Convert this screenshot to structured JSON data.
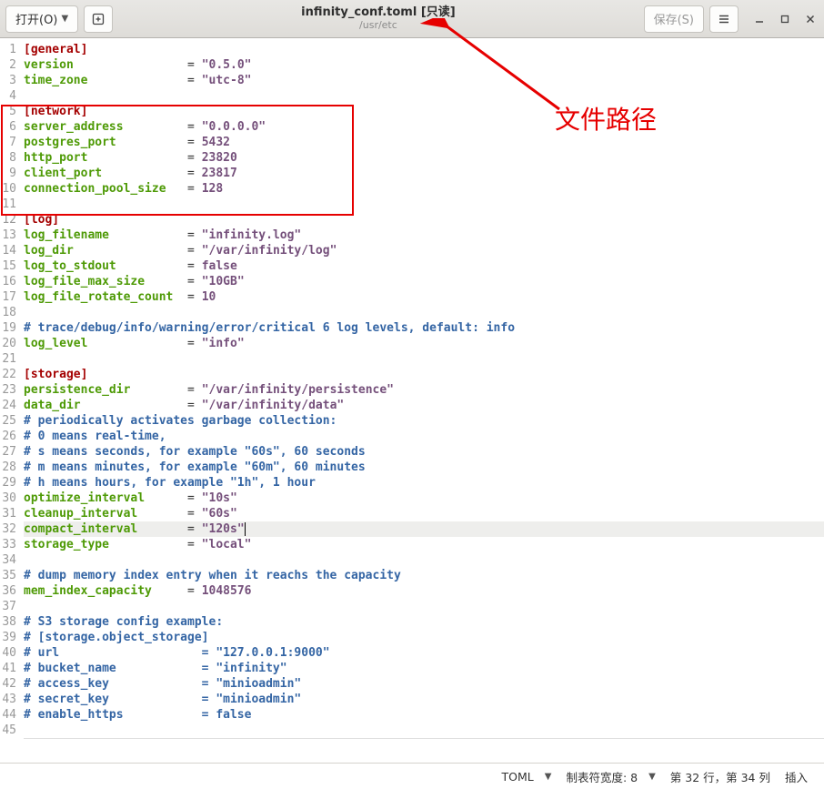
{
  "header": {
    "open_label": "打开(O)",
    "title": "infinity_conf.toml [只读]",
    "subtitle": "/usr/etc",
    "save_label": "保存(S)"
  },
  "annotation": {
    "label": "文件路径"
  },
  "lines": [
    {
      "n": 1,
      "t": "sec",
      "sec": "[general]"
    },
    {
      "n": 2,
      "t": "kv",
      "k": "version",
      "pad": "                ",
      "v": "\"0.5.0\"",
      "vt": "str"
    },
    {
      "n": 3,
      "t": "kv",
      "k": "time_zone",
      "pad": "              ",
      "v": "\"utc-8\"",
      "vt": "str"
    },
    {
      "n": 4,
      "t": "blank"
    },
    {
      "n": 5,
      "t": "sec",
      "sec": "[network]"
    },
    {
      "n": 6,
      "t": "kv",
      "k": "server_address",
      "pad": "         ",
      "v": "\"0.0.0.0\"",
      "vt": "str"
    },
    {
      "n": 7,
      "t": "kv",
      "k": "postgres_port",
      "pad": "          ",
      "v": "5432",
      "vt": "num"
    },
    {
      "n": 8,
      "t": "kv",
      "k": "http_port",
      "pad": "              ",
      "v": "23820",
      "vt": "num"
    },
    {
      "n": 9,
      "t": "kv",
      "k": "client_port",
      "pad": "            ",
      "v": "23817",
      "vt": "num"
    },
    {
      "n": 10,
      "t": "kv",
      "k": "connection_pool_size",
      "pad": "   ",
      "v": "128",
      "vt": "num"
    },
    {
      "n": 11,
      "t": "blank"
    },
    {
      "n": 12,
      "t": "sec",
      "sec": "[log]"
    },
    {
      "n": 13,
      "t": "kv",
      "k": "log_filename",
      "pad": "           ",
      "v": "\"infinity.log\"",
      "vt": "str"
    },
    {
      "n": 14,
      "t": "kv",
      "k": "log_dir",
      "pad": "                ",
      "v": "\"/var/infinity/log\"",
      "vt": "str"
    },
    {
      "n": 15,
      "t": "kv",
      "k": "log_to_stdout",
      "pad": "          ",
      "v": "false",
      "vt": "bool"
    },
    {
      "n": 16,
      "t": "kv",
      "k": "log_file_max_size",
      "pad": "      ",
      "v": "\"10GB\"",
      "vt": "str"
    },
    {
      "n": 17,
      "t": "kv",
      "k": "log_file_rotate_count",
      "pad": "  ",
      "v": "10",
      "vt": "num"
    },
    {
      "n": 18,
      "t": "blank"
    },
    {
      "n": 19,
      "t": "com",
      "c": "# trace/debug/info/warning/error/critical 6 log levels, default: info"
    },
    {
      "n": 20,
      "t": "kv",
      "k": "log_level",
      "pad": "              ",
      "v": "\"info\"",
      "vt": "str"
    },
    {
      "n": 21,
      "t": "blank"
    },
    {
      "n": 22,
      "t": "sec",
      "sec": "[storage]"
    },
    {
      "n": 23,
      "t": "kv",
      "k": "persistence_dir",
      "pad": "        ",
      "v": "\"/var/infinity/persistence\"",
      "vt": "str"
    },
    {
      "n": 24,
      "t": "kv",
      "k": "data_dir",
      "pad": "               ",
      "v": "\"/var/infinity/data\"",
      "vt": "str"
    },
    {
      "n": 25,
      "t": "com",
      "c": "# periodically activates garbage collection:"
    },
    {
      "n": 26,
      "t": "com",
      "c": "# 0 means real-time,"
    },
    {
      "n": 27,
      "t": "com",
      "c": "# s means seconds, for example \"60s\", 60 seconds"
    },
    {
      "n": 28,
      "t": "com",
      "c": "# m means minutes, for example \"60m\", 60 minutes"
    },
    {
      "n": 29,
      "t": "com",
      "c": "# h means hours, for example \"1h\", 1 hour"
    },
    {
      "n": 30,
      "t": "kv",
      "k": "optimize_interval",
      "pad": "      ",
      "v": "\"10s\"",
      "vt": "str"
    },
    {
      "n": 31,
      "t": "kv",
      "k": "cleanup_interval",
      "pad": "       ",
      "v": "\"60s\"",
      "vt": "str"
    },
    {
      "n": 32,
      "t": "kv",
      "k": "compact_interval",
      "pad": "       ",
      "v": "\"120s\"",
      "vt": "str",
      "cur": true
    },
    {
      "n": 33,
      "t": "kv",
      "k": "storage_type",
      "pad": "           ",
      "v": "\"local\"",
      "vt": "str"
    },
    {
      "n": 34,
      "t": "blank"
    },
    {
      "n": 35,
      "t": "com",
      "c": "# dump memory index entry when it reachs the capacity"
    },
    {
      "n": 36,
      "t": "kv",
      "k": "mem_index_capacity",
      "pad": "     ",
      "v": "1048576",
      "vt": "num"
    },
    {
      "n": 37,
      "t": "blank"
    },
    {
      "n": 38,
      "t": "com",
      "c": "# S3 storage config example:"
    },
    {
      "n": 39,
      "t": "com",
      "c": "# [storage.object_storage]"
    },
    {
      "n": 40,
      "t": "com",
      "c": "# url                    = \"127.0.0.1:9000\""
    },
    {
      "n": 41,
      "t": "com",
      "c": "# bucket_name            = \"infinity\""
    },
    {
      "n": 42,
      "t": "com",
      "c": "# access_key             = \"minioadmin\""
    },
    {
      "n": 43,
      "t": "com",
      "c": "# secret_key             = \"minioadmin\""
    },
    {
      "n": 44,
      "t": "com",
      "c": "# enable_https           = false"
    },
    {
      "n": 45,
      "t": "blank",
      "last": true
    }
  ],
  "statusbar": {
    "lang": "TOML",
    "tabwidth_label": "制表符宽度: 8",
    "position": "第 32 行，第 34 列",
    "mode": "插入"
  }
}
